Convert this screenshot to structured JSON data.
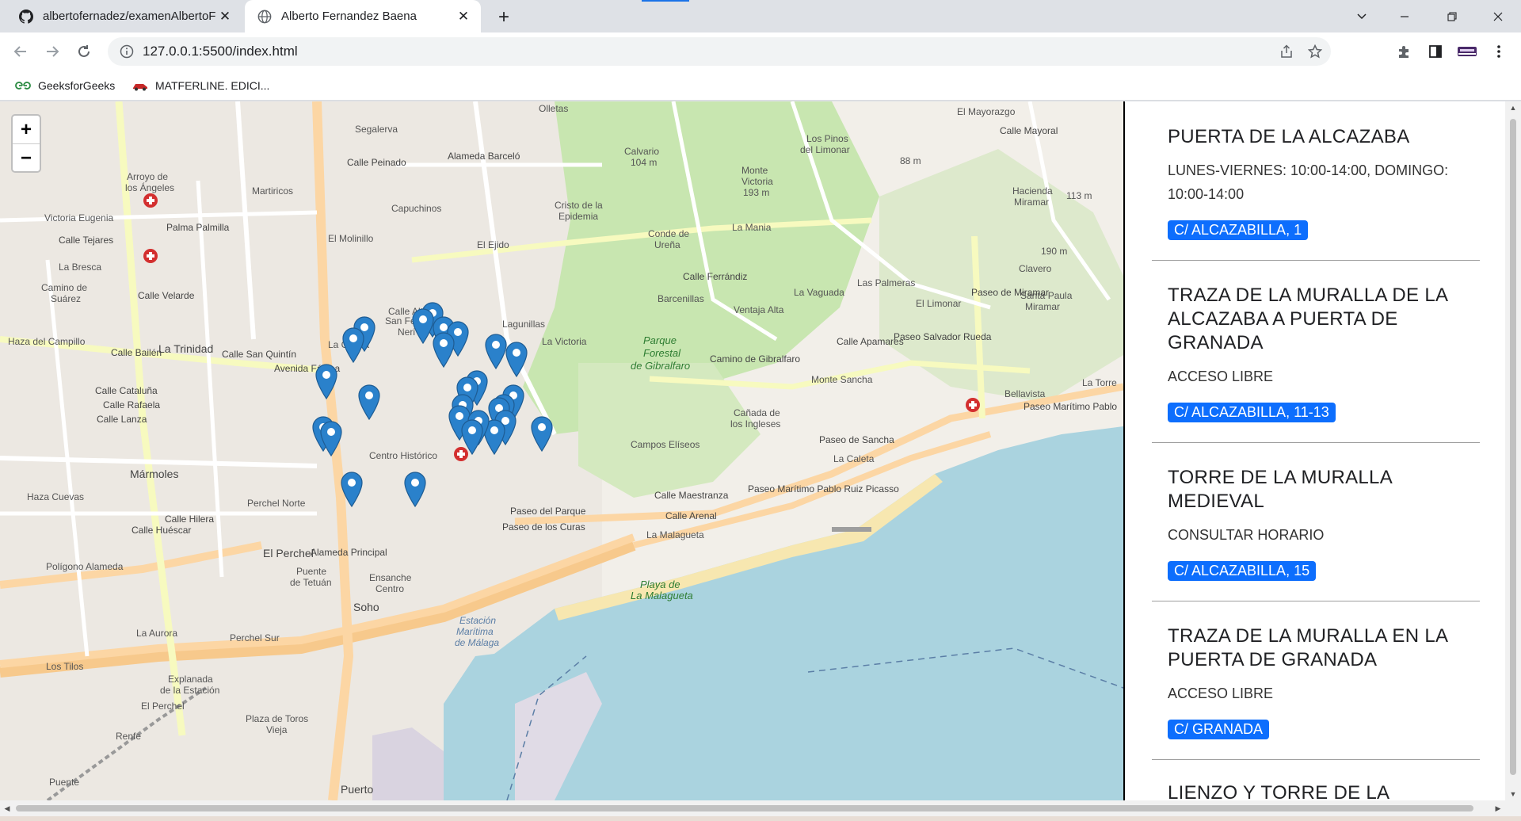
{
  "browser": {
    "tabs": [
      {
        "title": "albertofernadez/examenAlbertoF",
        "icon": "github-icon",
        "active": false
      },
      {
        "title": "Alberto Fernandez Baena",
        "icon": "globe-icon",
        "active": true
      }
    ],
    "url": "127.0.0.1:5500/index.html",
    "bookmarks": [
      {
        "label": "GeeksforGeeks",
        "icon": "geeksforgeeks-icon"
      },
      {
        "label": "MATFERLINE. EDICI...",
        "icon": "car-icon"
      }
    ]
  },
  "map": {
    "zoom_in": "+",
    "zoom_out": "−",
    "labels": [
      "Segalerva",
      "Olletas",
      "Calle Peinado",
      "Alameda Barceló",
      "Calvario",
      "104 m",
      "Cristo de la",
      "Epidemia",
      "Capuchinos",
      "Monte",
      "Victoria",
      "193 m",
      "Los Pinos",
      "del Limonar",
      "El Mayorazgo",
      "Calle Mayoral",
      "Hacienda",
      "Miramar",
      "Arroyo de",
      "los Ángeles",
      "Martiricos",
      "Victoria Eugenia",
      "El Molinillo",
      "El Ejido",
      "Conde de",
      "Ureña",
      "La Mania",
      "Clavero",
      "La Bresca",
      "Camino de",
      "Suárez",
      "Calle Velarde",
      "Calle Ferrándiz",
      "Barcenillas",
      "Ventaja Alta",
      "La Vaguada",
      "Las Palmeras",
      "El Limonar",
      "Santa Paula",
      "Miramar",
      "Haza del Campillo",
      "La Trinidad",
      "Calle San Quintín",
      "La Goleta",
      "Calle Alta",
      "San Felipe",
      "Neri",
      "Lagunillas",
      "La Victoria",
      "Parque",
      "Forestal",
      "de Gibralfaro",
      "Monte Sancha",
      "Bellavista",
      "La Torre",
      "Paseo Marítimo Pablo",
      "Cañada de",
      "los Ingleses",
      "Campos Elíseos",
      "Paseo de Sancha",
      "La Caleta",
      "Centro Histórico",
      "Mármoles",
      "Haza Cuevas",
      "Perchel Norte",
      "Calle Huéscar",
      "El Perchel",
      "Polígono Alameda",
      "Puente",
      "de Tetuán",
      "Ensanche",
      "Centro",
      "Soho",
      "Paseo del Parque",
      "Paseo de los Curas",
      "La Malagueta",
      "Calle Maestranza",
      "Calle Arenal",
      "Playa de",
      "La Malagueta",
      "Estación",
      "Marítima",
      "de Málaga",
      "La Aurora",
      "Perchel Sur",
      "Los Tilos",
      "Explanada",
      "de la Estación",
      "El Perchel",
      "Plaza de Toros",
      "Vieja",
      "Renfe",
      "Puente",
      "Puerto",
      "Calle Hilera",
      "Avenida Fátima",
      "Calle Bailén",
      "Calle Cataluña",
      "Calle Lanza",
      "Alameda Principal",
      "Paseo Marítimo Pablo Ruiz Picasso",
      "88 m",
      "190 m",
      "113 m",
      "Camino de Gibralfaro",
      "Calle Apamares",
      "Paseo Salvador Rueda",
      "Paseo de Miramar",
      "Calle Tejares",
      "Palma Palmilla",
      "Calle Rafaela"
    ]
  },
  "monuments": [
    {
      "name": "PUERTA DE LA ALCAZABA",
      "schedule": "LUNES-VIERNES: 10:00-14:00, DOMINGO: 10:00-14:00",
      "address": "C/ ALCAZABILLA, 1"
    },
    {
      "name": "TRAZA DE LA MURALLA DE LA ALCAZABA A PUERTA DE GRANADA",
      "schedule": "ACCESO LIBRE",
      "address": "C/ ALCAZABILLA, 11-13"
    },
    {
      "name": "TORRE DE LA MURALLA MEDIEVAL",
      "schedule": "CONSULTAR HORARIO",
      "address": "C/ ALCAZABILLA, 15"
    },
    {
      "name": "TRAZA DE LA MURALLA EN LA PUERTA DE GRANADA",
      "schedule": "ACCESO LIBRE",
      "address": "C/ GRANADA"
    },
    {
      "name": "LIENZO Y TORRE DE LA",
      "schedule": "",
      "address": ""
    }
  ],
  "colors": {
    "accent": "#0d6efd",
    "marker": "#2a81cb",
    "sea": "#aad3df",
    "park": "#c8e6b0"
  }
}
